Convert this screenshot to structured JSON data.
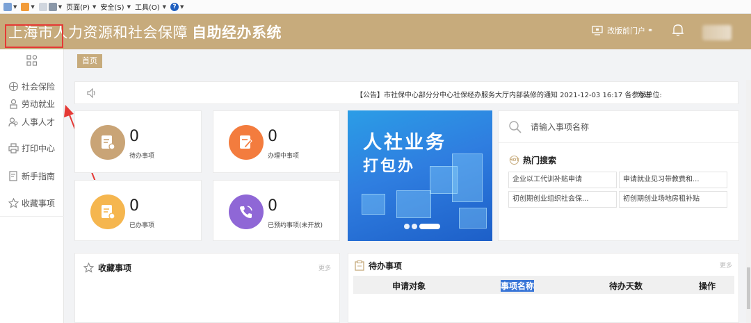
{
  "ie_toolbar": {
    "page_menu": "页面(P)",
    "safety_menu": "安全(S)",
    "tools_menu": "工具(O)"
  },
  "header": {
    "title_main": "上海市人力资源和社会保障",
    "title_bold": "自助经办系统",
    "portal_link": "改版前门户",
    "bell_icon": "bell-icon"
  },
  "sidebar": {
    "items": [
      {
        "label": "社会保险",
        "icon": "shield-icon"
      },
      {
        "label": "劳动就业",
        "icon": "worker-icon"
      },
      {
        "label": "人事人才",
        "icon": "users-icon"
      },
      {
        "label": "打印中心",
        "icon": "printer-icon"
      },
      {
        "label": "新手指南",
        "icon": "guide-icon"
      },
      {
        "label": "收藏事项",
        "icon": "star-icon"
      }
    ]
  },
  "breadcrumb": {
    "tab": "首页"
  },
  "notice": {
    "text": "【公告】市社保中心部分分中心社保经办服务大厅内部装修的通知 2021-12-03 16:17 各参保单位:",
    "text_tail": "为进"
  },
  "stats": [
    {
      "value": "0",
      "label": "待办事项",
      "color": "#c9a476"
    },
    {
      "value": "0",
      "label": "办理中事项",
      "color": "#f37c3e"
    },
    {
      "value": "0",
      "label": "已办事项",
      "color": "#f5b64f"
    },
    {
      "value": "0",
      "label": "已预约事项(未开放)",
      "color": "#8f67d6"
    }
  ],
  "banner": {
    "line1": "人社业务",
    "line2": "打包办"
  },
  "search": {
    "placeholder": "请输入事项名称",
    "hot_title": "热门搜索",
    "hot_badge": "HOT",
    "tags": [
      "企业以工代训补贴申请",
      "申请就业见习带教费和...",
      "初创期创业组织社会保...",
      "初创期创业场地房租补贴"
    ]
  },
  "favorites": {
    "title": "收藏事项",
    "more": "更多"
  },
  "todo": {
    "title": "待办事项",
    "more": "更多",
    "columns": [
      "申请对象",
      "事项名称",
      "待办天数",
      "操作"
    ]
  },
  "colors": {
    "brand": "#c7ab7c",
    "annotation_red": "#e53935"
  }
}
